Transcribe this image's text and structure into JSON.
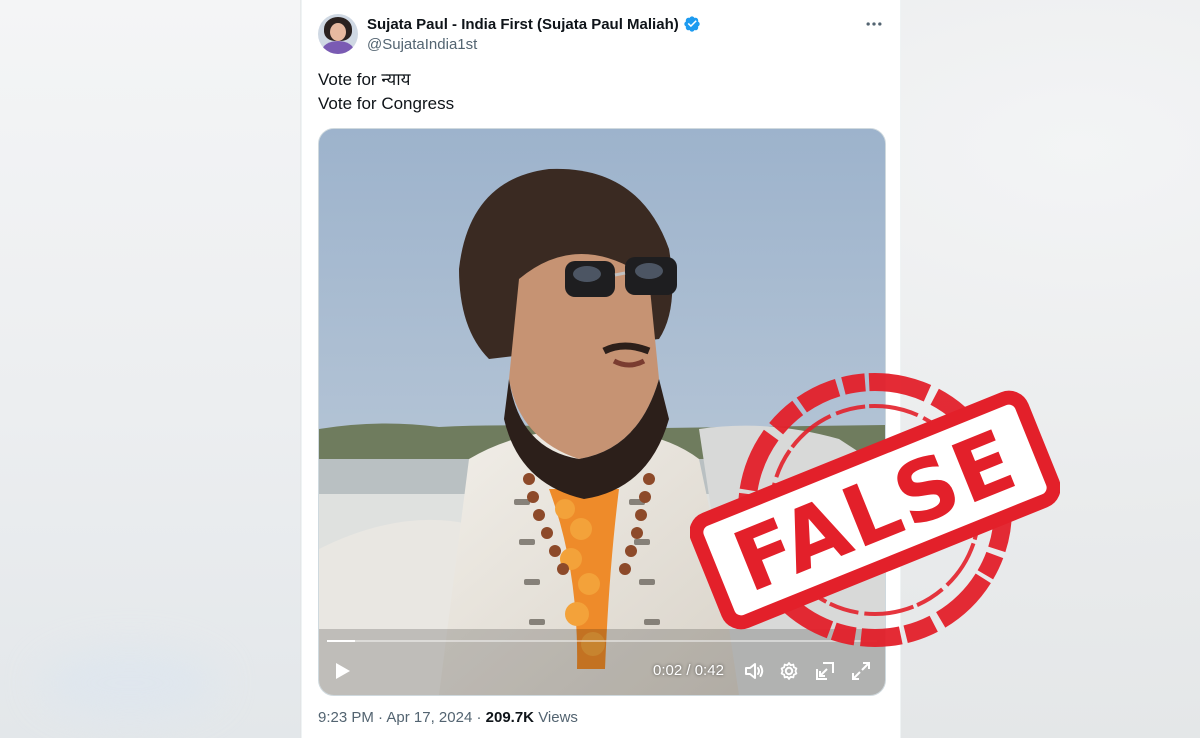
{
  "author": {
    "display_name": "Sujata Paul - India First (Sujata Paul Maliah)",
    "handle": "@SujataIndia1st",
    "verified": true
  },
  "tweet": {
    "lines": [
      "Vote for न्याय",
      "Vote for Congress"
    ]
  },
  "video": {
    "current_time": "0:02",
    "duration": "0:42",
    "progress": 0.05
  },
  "meta": {
    "time": "9:23 PM",
    "separator": "·",
    "date": "Apr 17, 2024",
    "views_count": "209.7K",
    "views_label": "Views"
  },
  "stamp": {
    "text": "FALSE",
    "color": "#e3202a"
  },
  "icons": {
    "more": "more-icon",
    "verified": "verified-badge-icon",
    "play": "play-icon",
    "volume": "volume-icon",
    "settings": "gear-icon",
    "pip": "picture-in-picture-icon",
    "fullscreen": "fullscreen-icon"
  }
}
